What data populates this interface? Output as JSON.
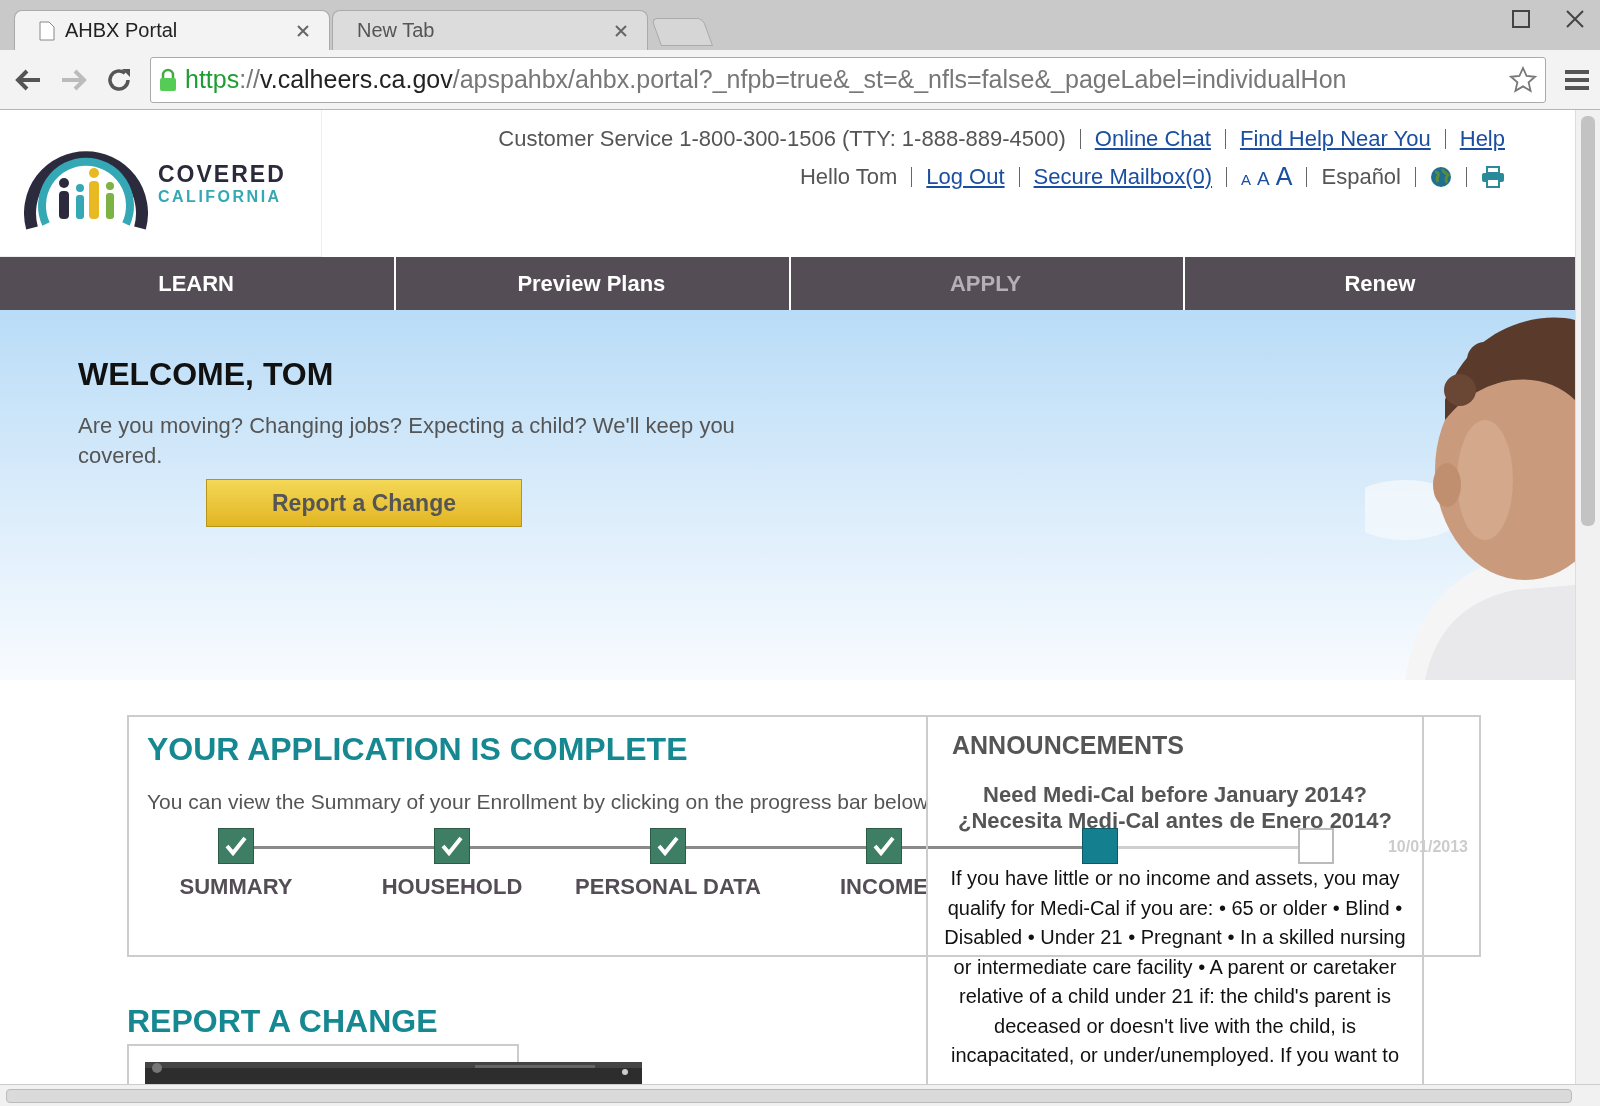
{
  "browser": {
    "tabs": [
      {
        "title": "AHBX Portal",
        "selected": true
      },
      {
        "title": "New Tab",
        "selected": false
      }
    ],
    "address": {
      "scheme": "https",
      "separator": "://",
      "host": "v.calheers.ca.gov",
      "path": "/apspahbx/ahbx.portal?_nfpb=true&_st=&_nfls=false&_pageLabel=individualHon"
    }
  },
  "logo": {
    "line1": "COVERED",
    "line2": "CALIFORNIA"
  },
  "utility": {
    "customer_service": "Customer Service 1-800-300-1506 (TTY: 1-888-889-4500)",
    "top_links": [
      "Online Chat",
      "Find Help Near You",
      "Help"
    ],
    "greeting": "Hello Tom",
    "account_links": [
      "Log Out",
      "Secure Mailbox(0)"
    ],
    "font_sizes": [
      "A",
      "A",
      "A"
    ],
    "language": "Español"
  },
  "nav": [
    {
      "label": "LEARN",
      "disabled": false
    },
    {
      "label": "Preview Plans",
      "disabled": false
    },
    {
      "label": "APPLY",
      "disabled": true
    },
    {
      "label": "Renew",
      "disabled": false
    }
  ],
  "hero": {
    "title": "WELCOME, TOM",
    "text": "Are you moving? Changing jobs? Expecting a child? We'll keep you covered.",
    "button": "Report a Change"
  },
  "application": {
    "title": "YOUR APPLICATION IS COMPLETE",
    "subtitle": "You can view the Summary of your Enrollment by clicking on the progress bar below",
    "steps": [
      {
        "label": "SUMMARY",
        "kind": "done"
      },
      {
        "label": "HOUSEHOLD",
        "kind": "done"
      },
      {
        "label": "PERSONAL DATA",
        "kind": "done"
      },
      {
        "label": "INCOME",
        "kind": "done"
      },
      {
        "kind": "current"
      },
      {
        "kind": "pending"
      }
    ]
  },
  "announcements": {
    "title": "ANNOUNCEMENTS",
    "headline": "Need Medi-Cal before January 2014?",
    "headline_es": "¿Necesita Medi-Cal antes de Enero 2014?",
    "date": "10/01/2013",
    "body": "If you have little or no income and assets, you may qualify for Medi-Cal if you are: • 65 or older • Blind • Disabled • Under 21 • Pregnant • In a skilled nursing or intermediate care facility • A parent or caretaker relative of a child under 21 if: the child's parent is deceased or doesn't live with the child, is incapacitated, or under/unemployed. If you want to"
  },
  "report": {
    "title": "REPORT A CHANGE"
  }
}
